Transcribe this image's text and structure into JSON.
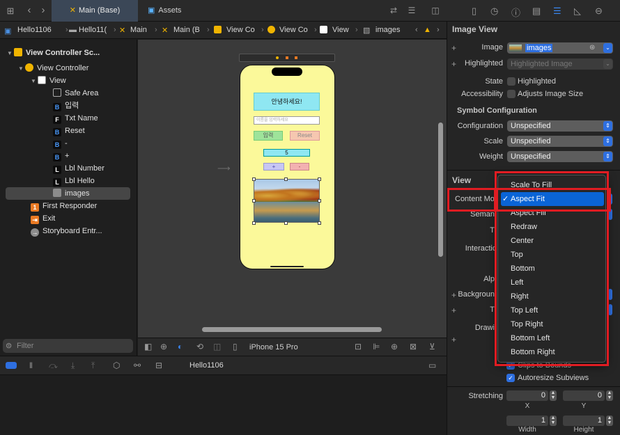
{
  "editor_tabs": {
    "main": "Main (Base)",
    "assets": "Assets"
  },
  "breadcrumbs": [
    "Hello1106",
    "Hello11(",
    "Main",
    "Main (B",
    "View Co",
    "View Co",
    "View",
    "images"
  ],
  "navigator": {
    "items": [
      {
        "label": "View Controller Sc...",
        "kind": "scene"
      },
      {
        "label": "View Controller",
        "kind": "vc"
      },
      {
        "label": "View",
        "kind": "view"
      },
      {
        "label": "Safe Area",
        "kind": "safe",
        "badge": ""
      },
      {
        "label": "입력",
        "kind": "button",
        "badge": "B"
      },
      {
        "label": "Txt Name",
        "kind": "field",
        "badge": "F"
      },
      {
        "label": "Reset",
        "kind": "button",
        "badge": "B"
      },
      {
        "label": "-",
        "kind": "button",
        "badge": "B"
      },
      {
        "label": "+",
        "kind": "button",
        "badge": "B"
      },
      {
        "label": "Lbl Number",
        "kind": "label",
        "badge": "L"
      },
      {
        "label": "Lbl Hello",
        "kind": "label",
        "badge": "L"
      },
      {
        "label": "images",
        "kind": "image",
        "badge": ""
      },
      {
        "label": "First Responder",
        "kind": "responder",
        "badge": "1"
      },
      {
        "label": "Exit",
        "kind": "exit",
        "badge": ""
      },
      {
        "label": "Storyboard Entr...",
        "kind": "entry",
        "badge": ""
      }
    ],
    "filter_placeholder": "Filter"
  },
  "canvas": {
    "device": "iPhone 15 Pro",
    "hello_label": "안녕하세요!",
    "name_placeholder": "이름을 입력하세요",
    "input_button": "입력",
    "reset_button": "Reset",
    "number_label": "5",
    "plus_button": "+",
    "minus_button": "-"
  },
  "debug": {
    "scheme": "Hello1106"
  },
  "inspector": {
    "image_view_title": "Image View",
    "image_label": "Image",
    "image_value": "images",
    "highlighted_label": "Highlighted",
    "highlighted_placeholder": "Highlighted Image",
    "state_label": "State",
    "state_check": "Highlighted",
    "accessibility_label": "Accessibility",
    "accessibility_check": "Adjusts Image Size",
    "symbol_config_title": "Symbol Configuration",
    "configuration_label": "Configuration",
    "configuration_value": "Unspecified",
    "scale_label": "Scale",
    "scale_value": "Unspecified",
    "weight_label": "Weight",
    "weight_value": "Unspecified",
    "view_title": "View",
    "content_mode_label": "Content Mo",
    "semantic_label": "Seman",
    "tag_label": "T",
    "interaction_label": "Interactio",
    "alpha_label": "Alp",
    "background_label": "Backgroun",
    "tint_label": "T",
    "drawing_label": "Drawi",
    "clips_label": "Clips to Bounds",
    "autoresize_label": "Autoresize Subviews",
    "stretching_label": "Stretching",
    "stretch_x": "0",
    "stretch_y": "0",
    "x_label": "X",
    "y_label": "Y",
    "stretch_w": "1",
    "stretch_h": "1",
    "width_label": "Width",
    "height_label": "Height"
  },
  "content_mode_menu": {
    "options": [
      "Scale To Fill",
      "Aspect Fit",
      "Aspect Fill",
      "Redraw",
      "Center",
      "Top",
      "Bottom",
      "Left",
      "Right",
      "Top Left",
      "Top Right",
      "Bottom Left",
      "Bottom Right"
    ],
    "selected": "Aspect Fit"
  },
  "colors": {
    "accent": "#0a64d6",
    "highlight": "#e01c22",
    "canvas_bg": "#fbf99a"
  }
}
